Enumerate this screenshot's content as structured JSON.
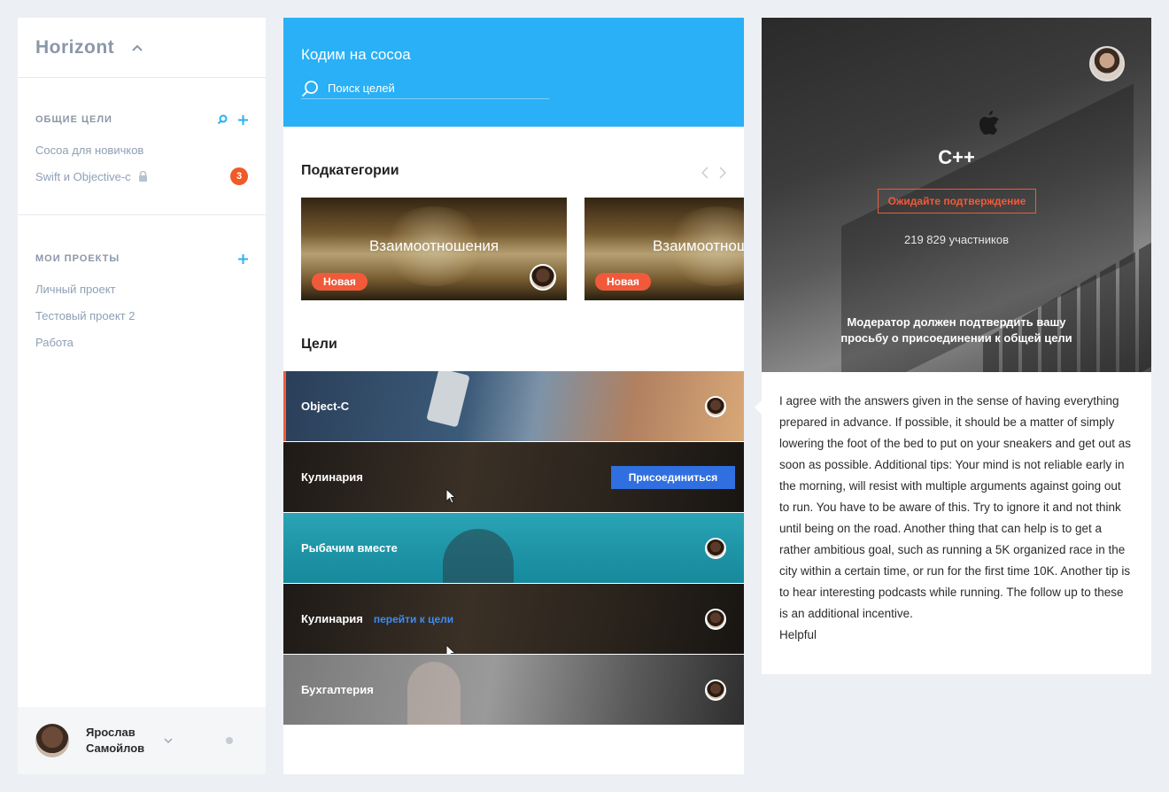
{
  "sidebar": {
    "brand": "Horizont",
    "sections": [
      {
        "title": "ОБЩИЕ ЦЕЛИ",
        "items": [
          {
            "label": "Cocoa для новичков"
          },
          {
            "label": "Swift и Objective-c",
            "locked": true,
            "badge": "3"
          }
        ]
      },
      {
        "title": "МОИ ПРОЕКТЫ",
        "items": [
          {
            "label": "Личный проект"
          },
          {
            "label": "Тестовый проект 2"
          },
          {
            "label": "Работа"
          }
        ]
      }
    ],
    "user": {
      "name": "Ярослав Самойлов"
    }
  },
  "header": {
    "title": "Кодим на cocoa",
    "search_placeholder": "Поиск целей"
  },
  "subcategories": {
    "title": "Подкатегории",
    "cards": [
      {
        "title": "Взаимоотношения",
        "badge": "Новая"
      },
      {
        "title": "Взаимоотношения",
        "badge": "Новая"
      }
    ]
  },
  "goals": {
    "title": "Цели",
    "items": [
      {
        "name": "Object-C"
      },
      {
        "name": "Кулинария",
        "button": "Присоединиться"
      },
      {
        "name": "Рыбачим вместе"
      },
      {
        "name": "Кулинария",
        "link": "перейти к цели"
      },
      {
        "name": "Бухгалтерия"
      }
    ]
  },
  "detail": {
    "title": "C++",
    "status": "Ожидайте подтверждение",
    "members": "219 829 участников",
    "note": "Модератор должен подтвердить вашу просьбу о присоединении к общей цели",
    "comment": "I agree with the answers given in the sense of having everything prepared in advance. If possible, it should be a matter of simply lowering the foot of the bed to put on your sneakers and get out as soon as possible. Additional tips: Your mind is not reliable early in the morning, will resist with multiple arguments against going out to run. You have to be aware of this. Try to ignore it and not think until being on the road. Another thing that can help is to get a rather ambitious goal, such as running a 5K organized race in the city within a certain time, or run for the first time 10K. Another tip is to hear interesting podcasts while running. The follow up to these is an additional incentive.",
    "helpful": "Helpful"
  },
  "colors": {
    "accent": "#29b0f6",
    "badge": "#f05a28",
    "join_button": "#2f6fe0",
    "link": "#3d8cf0",
    "sidebar_text": "#8ea0b5"
  },
  "icons": [
    "chevron-up-icon",
    "search-icon",
    "plus-icon",
    "lock-icon",
    "chevron-down-icon",
    "arrow-left-icon",
    "arrow-right-icon",
    "apple-icon",
    "cursor-icon",
    "avatar"
  ]
}
